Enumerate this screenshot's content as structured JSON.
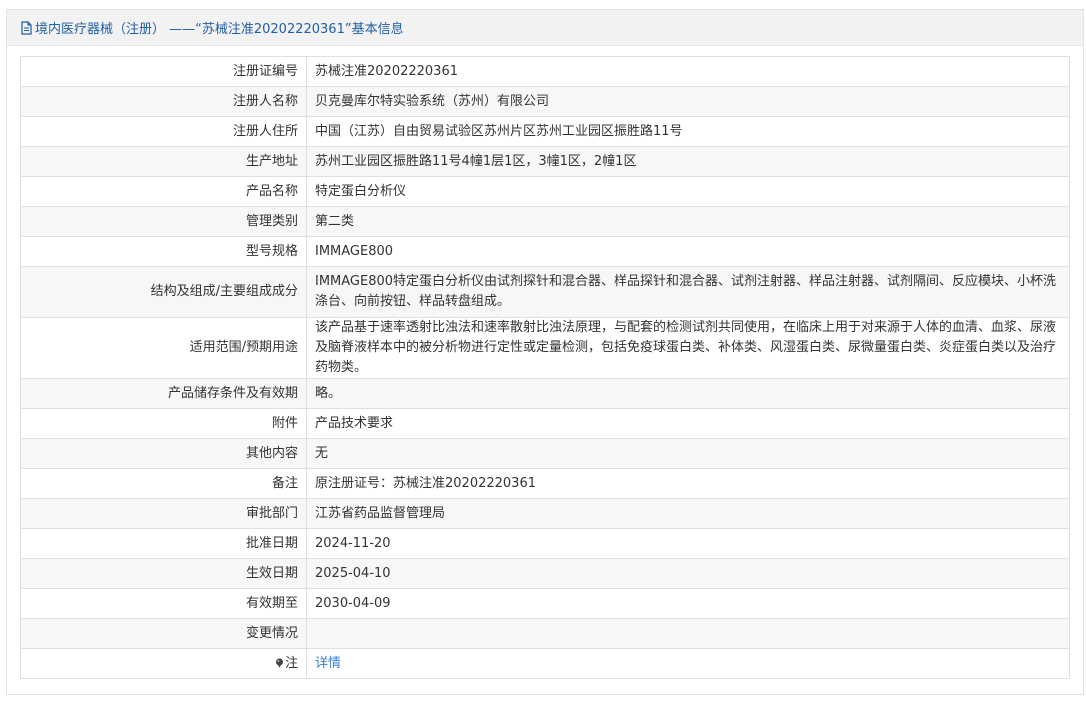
{
  "header": {
    "title": "境内医疗器械（注册） ——“苏械注准20202220361”基本信息"
  },
  "rows": [
    {
      "label": "注册证编号",
      "value": "苏械注准20202220361"
    },
    {
      "label": "注册人名称",
      "value": "贝克曼库尔特实验系统（苏州）有限公司"
    },
    {
      "label": "注册人住所",
      "value": "中国（江苏）自由贸易试验区苏州片区苏州工业园区振胜路11号"
    },
    {
      "label": "生产地址",
      "value": "苏州工业园区振胜路11号4幢1层1区，3幢1区，2幢1区"
    },
    {
      "label": "产品名称",
      "value": "特定蛋白分析仪"
    },
    {
      "label": "管理类别",
      "value": "第二类"
    },
    {
      "label": "型号规格",
      "value": "IMMAGE800"
    },
    {
      "label": "结构及组成/主要组成成分",
      "value": "IMMAGE800特定蛋白分析仪由试剂探针和混合器、样品探针和混合器、试剂注射器、样品注射器、试剂隔间、反应模块、小杯洗涤台、向前按钮、样品转盘组成。"
    },
    {
      "label": "适用范围/预期用途",
      "value": "该产品基于速率透射比浊法和速率散射比浊法原理，与配套的检测试剂共同使用，在临床上用于对来源于人体的血清、血浆、尿液及脑脊液样本中的被分析物进行定性或定量检测，包括免疫球蛋白类、补体类、风湿蛋白类、尿微量蛋白类、炎症蛋白类以及治疗药物类。"
    },
    {
      "label": "产品储存条件及有效期",
      "value": "略。"
    },
    {
      "label": "附件",
      "value": "产品技术要求"
    },
    {
      "label": "其他内容",
      "value": "无"
    },
    {
      "label": "备注",
      "value": "原注册证号：苏械注准20202220361"
    },
    {
      "label": "审批部门",
      "value": "江苏省药品监督管理局"
    },
    {
      "label": "批准日期",
      "value": "2024-11-20"
    },
    {
      "label": "生效日期",
      "value": "2025-04-10"
    },
    {
      "label": "有效期至",
      "value": "2030-04-09"
    },
    {
      "label": "变更情况",
      "value": ""
    },
    {
      "label": "注",
      "value": "详情"
    }
  ],
  "colors": {
    "header_text": "#1f5ea8",
    "link": "#3a7fd5"
  },
  "icons": {
    "header": "document-icon",
    "note": "pin-icon"
  }
}
